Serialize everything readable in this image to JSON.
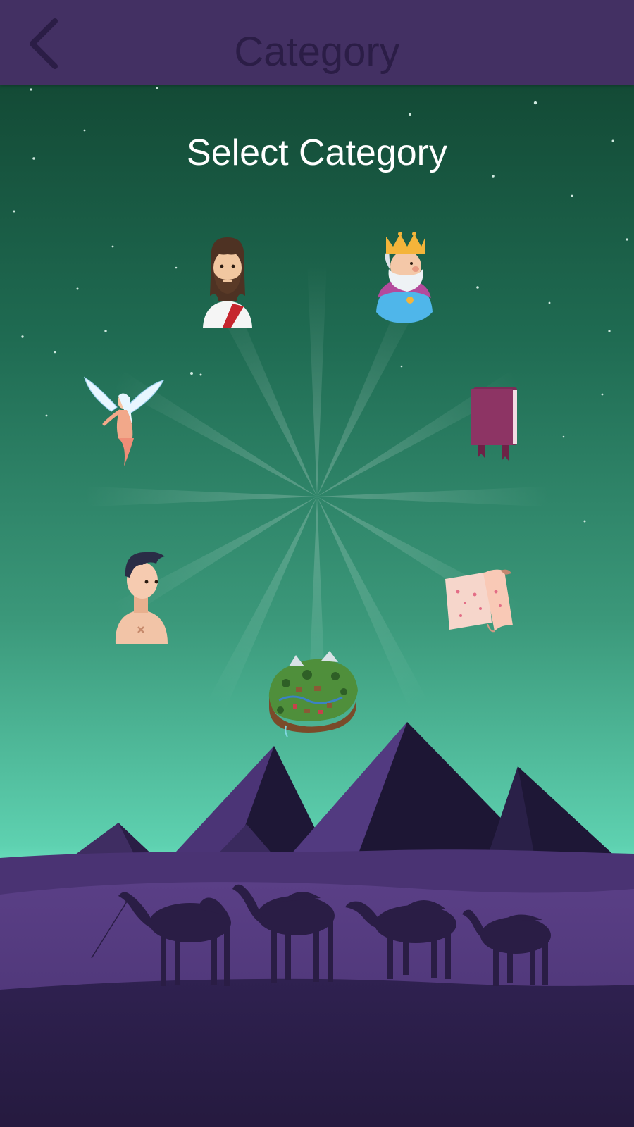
{
  "header": {
    "title": "Category",
    "back_icon": "chevron-left-icon"
  },
  "main": {
    "heading": "Select Category"
  },
  "categories": [
    {
      "icon": "jesus-icon"
    },
    {
      "icon": "king-icon"
    },
    {
      "icon": "angel-icon"
    },
    {
      "icon": "book-icon"
    },
    {
      "icon": "man-icon"
    },
    {
      "icon": "scroll-map-icon"
    },
    {
      "icon": "island-map-icon"
    }
  ],
  "colors": {
    "header_bg": "#433063",
    "header_text": "#2b1d46",
    "heading_text": "#ffffff"
  }
}
